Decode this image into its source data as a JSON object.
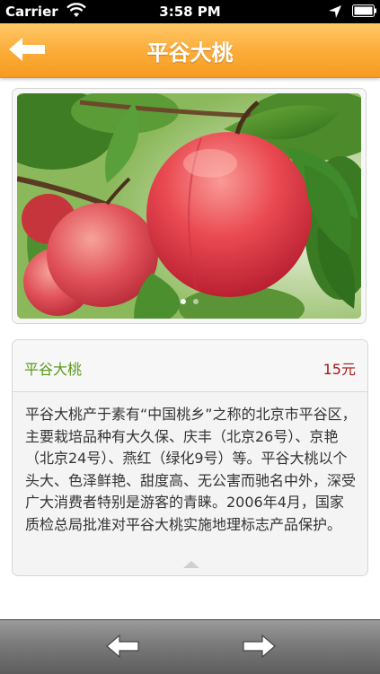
{
  "status_bar": {
    "carrier": "Carrier",
    "time": "3:58 PM"
  },
  "nav": {
    "title": "平谷大桃",
    "back_icon": "left-arrow-icon"
  },
  "gallery": {
    "image": "peach-photo",
    "page_count": 2,
    "current_page": 1
  },
  "product": {
    "name": "平谷大桃",
    "price": "15元",
    "description": "平谷大桃产于素有“中国桃乡”之称的北京市平谷区，主要栽培品种有大久保、庆丰（北京26号）、京艳（北京24号）、燕红（绿化9号）等。平谷大桃以个头大、色泽鲜艳、甜度高、无公害而驰名中外，深受广大消费者特别是游客的青睐。2006年4月，国家质检总局批准对平谷大桃实施地理标志产品保护。"
  },
  "toolbar": {
    "prev_icon": "left-arrow-icon",
    "next_icon": "right-arrow-icon"
  },
  "colors": {
    "nav_orange": "#fbab36",
    "name_green": "#5a9a1c",
    "price_red": "#a31a1a"
  }
}
